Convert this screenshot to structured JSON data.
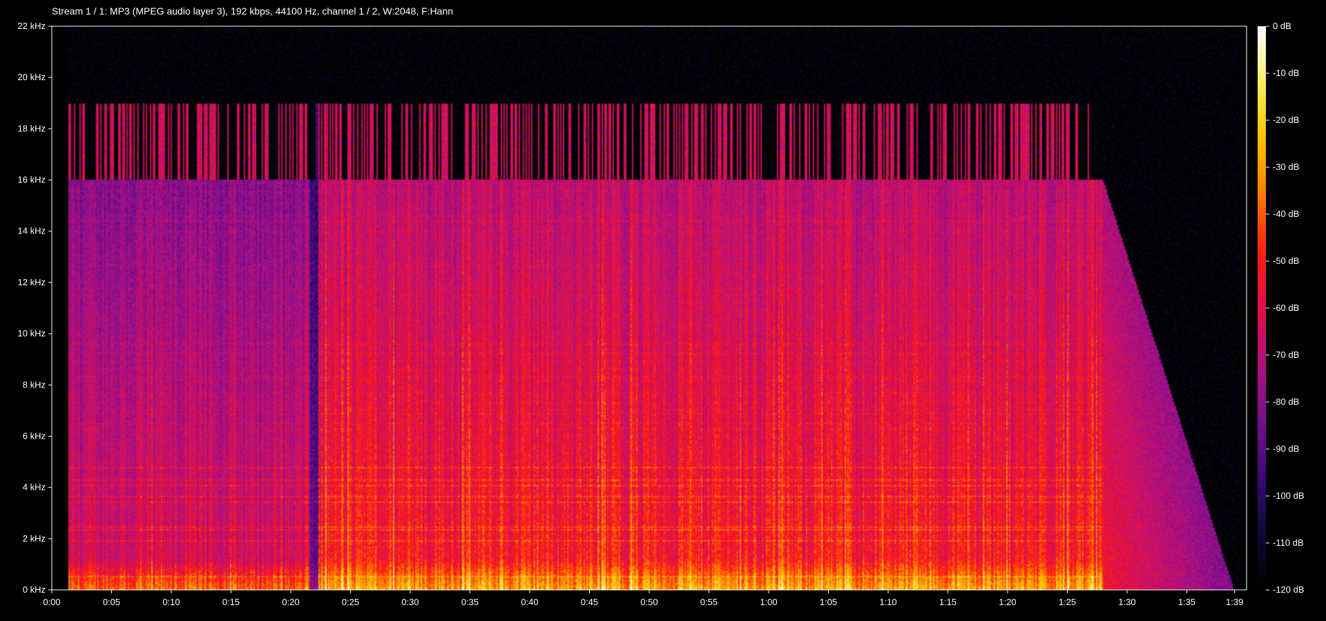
{
  "title": "Stream 1 / 1: MP3 (MPEG audio layer 3), 192 kbps, 44100 Hz, channel 1 / 2, W:2048, F:Hann",
  "chart_data": {
    "type": "heatmap",
    "title": "Stream 1 / 1: MP3 (MPEG audio layer 3), 192 kbps, 44100 Hz, channel 1 / 2, W:2048, F:Hann",
    "x_range_seconds": [
      0,
      100
    ],
    "y_range_hz": [
      0,
      22000
    ],
    "color_range_db": [
      -120,
      0
    ],
    "y_ticks": [
      "0 kHz",
      "2 kHz",
      "4 kHz",
      "6 kHz",
      "8 kHz",
      "10 kHz",
      "12 kHz",
      "14 kHz",
      "16 kHz",
      "18 kHz",
      "20 kHz",
      "22 kHz"
    ],
    "y_tick_values": [
      0,
      2000,
      4000,
      6000,
      8000,
      10000,
      12000,
      14000,
      16000,
      18000,
      20000,
      22000
    ],
    "x_ticks": [
      "0:00",
      "0:05",
      "0:10",
      "0:15",
      "0:20",
      "0:25",
      "0:30",
      "0:35",
      "0:40",
      "0:45",
      "0:50",
      "0:55",
      "1:00",
      "1:05",
      "1:10",
      "1:15",
      "1:20",
      "1:25",
      "1:30",
      "1:35",
      "1:39"
    ],
    "x_tick_values": [
      0,
      5,
      10,
      15,
      20,
      25,
      30,
      35,
      40,
      45,
      50,
      55,
      60,
      65,
      70,
      75,
      80,
      85,
      90,
      95,
      99
    ],
    "colorbar_ticks": [
      "0 dB",
      "-10 dB",
      "-20 dB",
      "-30 dB",
      "-40 dB",
      "-50 dB",
      "-60 dB",
      "-70 dB",
      "-80 dB",
      "-90 dB",
      "-100 dB",
      "-110 dB",
      "-120 dB"
    ],
    "colorbar_values": [
      0,
      -10,
      -20,
      -30,
      -40,
      -50,
      -60,
      -70,
      -80,
      -90,
      -100,
      -110,
      -120
    ],
    "colormap": [
      "#000000",
      "#0d0a3a",
      "#3a0a7a",
      "#7a0f8f",
      "#b0107f",
      "#e0104a",
      "#ff2010",
      "#ff7a00",
      "#ffc000",
      "#ffee60",
      "#ffffff"
    ],
    "features": {
      "lowpass_cutoff_hz": 16000,
      "sparse_content_max_hz": 19000,
      "signal_start_s": 1.4,
      "gap_s": [
        21.6,
        22.3
      ],
      "music_end_s": 88,
      "fadeout_end_s": 99.5
    }
  }
}
